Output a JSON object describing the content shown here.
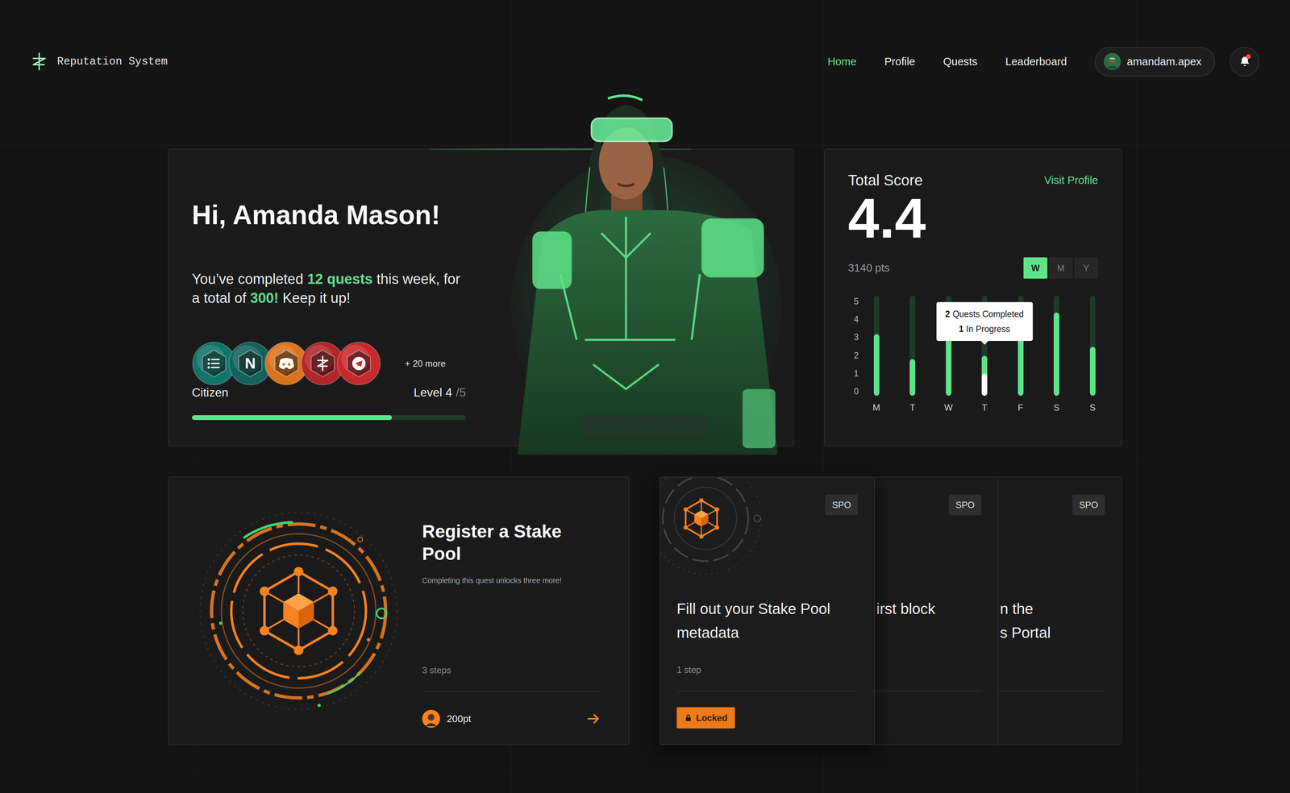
{
  "app": {
    "title": "Reputation System"
  },
  "nav": [
    {
      "label": "Home",
      "selected": true
    },
    {
      "label": "Profile",
      "selected": false
    },
    {
      "label": "Quests",
      "selected": false
    },
    {
      "label": "Leaderboard",
      "selected": false
    }
  ],
  "user": {
    "handle": "amandam.apex"
  },
  "notifications": {
    "unread": true
  },
  "hero": {
    "greeting": "Hi, Amanda Mason!",
    "summary": [
      {
        "text": "You’ve completed ",
        "highlight": false
      },
      {
        "text": "12 quests",
        "highlight": true
      },
      {
        "text": " this week, for a total of ",
        "highlight": false
      },
      {
        "text": "300!",
        "highlight": true
      },
      {
        "text": " Keep it up!",
        "highlight": false
      }
    ],
    "badges": [
      {
        "kind": "list",
        "color": "#0e7568"
      },
      {
        "kind": "notion",
        "glyph": "N",
        "color": "#13625c"
      },
      {
        "kind": "discord",
        "color": "#d9741c"
      },
      {
        "kind": "logo",
        "color": "#b3262a"
      },
      {
        "kind": "telegram",
        "color": "#c7282c"
      }
    ],
    "more": "+ 20 more",
    "rank": "Citizen",
    "level_label": "Level 4",
    "level_max": "/5",
    "level": 0.73
  },
  "score": {
    "title": "Total Score",
    "link": "Visit Profile",
    "value": "4.4",
    "points": "3140 pts",
    "ranges": [
      {
        "label": "W",
        "selected": true
      },
      {
        "label": "M",
        "selected": false
      },
      {
        "label": "Y",
        "selected": false
      }
    ],
    "chart": {
      "ticks": [
        "5",
        "4",
        "3",
        "2",
        "1",
        "0"
      ],
      "days": [
        "M",
        "T",
        "W",
        "T",
        "F",
        "S",
        "S"
      ],
      "completed": [
        3.2,
        1.8,
        3.5,
        2,
        3.2,
        4.4,
        2.5
      ],
      "in_progress": [
        0,
        0,
        0,
        1,
        0,
        0,
        0
      ],
      "hovered": [
        false,
        false,
        false,
        true,
        false,
        false,
        false
      ]
    },
    "tooltip": {
      "completed_count": "2",
      "completed_label": "Quests Completed",
      "progress_count": "1",
      "progress_label": "In Progress"
    }
  },
  "featured": {
    "title": "Register a Stake Pool",
    "subtitle": "Completing this quest unlocks three more!",
    "steps": "3 steps",
    "points": "200pt"
  },
  "queue": [
    {
      "kind": "card",
      "tag": "SPO",
      "title": "Fill out your Stake Pool metadata",
      "steps": "1 step",
      "status": "Locked",
      "locked": true
    },
    {
      "kind": "slice",
      "tag": "SPO",
      "lines": [
        "irst block"
      ]
    },
    {
      "kind": "slice",
      "tag": "SPO",
      "lines": [
        "n the",
        "s Portal"
      ]
    }
  ]
}
